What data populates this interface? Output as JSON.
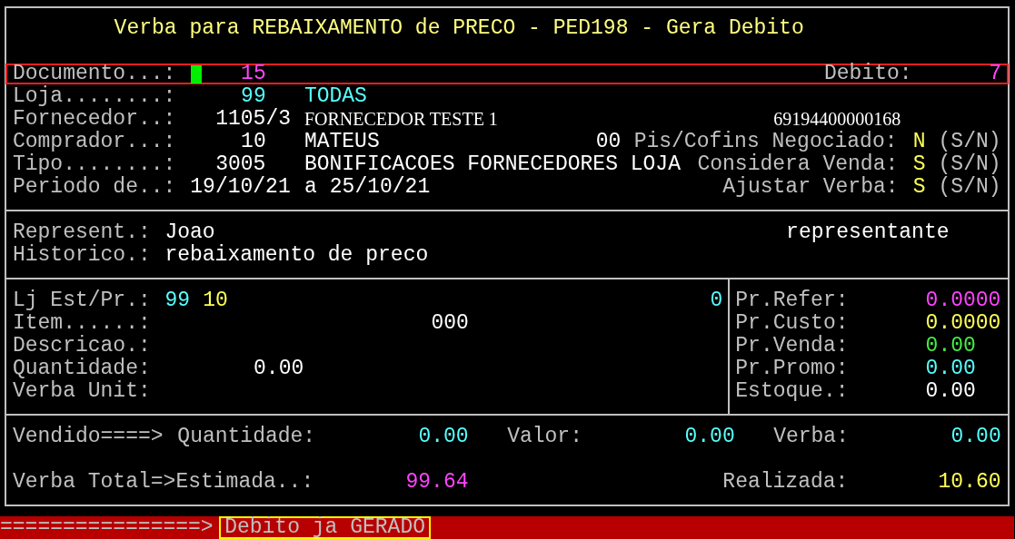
{
  "title": "Verba para REBAIXAMENTO de PRECO - PED198 - Gera Debito",
  "documento": {
    "label": "Documento...:",
    "value": "15",
    "cursor": true,
    "highlighted": true
  },
  "debito": {
    "label": "Debito:",
    "value": "7"
  },
  "loja": {
    "label": "Loja........:",
    "code": "99",
    "name": "TODAS"
  },
  "fornecedor": {
    "label": "Fornecedor..:",
    "code": "1105/3",
    "name": "FORNECEDOR TESTE 1",
    "cnpj": "69194400000168"
  },
  "comprador": {
    "label": "Comprador...:",
    "code": "10",
    "name": "MATEUS",
    "extra": "00"
  },
  "tipo": {
    "label": "Tipo........:",
    "code": "3005",
    "name": "BONIFICACOES FORNECEDORES LOJA"
  },
  "periodo": {
    "label": "Periodo de..:",
    "from": "19/10/21",
    "separator": "a",
    "to": "25/10/21"
  },
  "flags": [
    {
      "label": "Pis/Cofins Negociado:",
      "value": "N",
      "hint": "(S/N)"
    },
    {
      "label": "Considera Venda:",
      "value": "S",
      "hint": "(S/N)"
    },
    {
      "label": "Ajustar Verba:",
      "value": "S",
      "hint": "(S/N)"
    }
  ],
  "represent": {
    "label": "Represent.:",
    "value": "Joao",
    "role": "representante"
  },
  "historico": {
    "label": "Historico.:",
    "value": "rebaixamento de preco"
  },
  "item": {
    "loja_label": "Lj Est/Pr.:",
    "loja": "99",
    "estoque": "10",
    "count": "0",
    "item_label": "Item......:",
    "item": "000",
    "descricao_label": "Descricao.:",
    "quantidade_label": "Quantidade:",
    "quantidade": "0.00",
    "verba_label": "Verba Unit:"
  },
  "prices": [
    {
      "label": "Pr.Refer:",
      "value": "0.0000"
    },
    {
      "label": "Pr.Custo:",
      "value": "0.0000"
    },
    {
      "label": "Pr.Venda:",
      "value": "0.00"
    },
    {
      "label": "Pr.Promo:",
      "value": "0.00"
    },
    {
      "label": "Estoque.:",
      "value": "0.00"
    }
  ],
  "vendido": {
    "label": "Vendido====>",
    "quantidade_label": "Quantidade:",
    "quantidade": "0.00",
    "valor_label": "Valor:",
    "valor": "0.00",
    "verba_label": "Verba:",
    "verba": "0.00"
  },
  "total": {
    "label": "Verba Total=>Estimada..:",
    "estimada": "99.64",
    "realizada_label": "Realizada:",
    "realizada": "10.60"
  },
  "status_bar": {
    "arrow": "================>",
    "message": "Debito ja GERADO"
  }
}
